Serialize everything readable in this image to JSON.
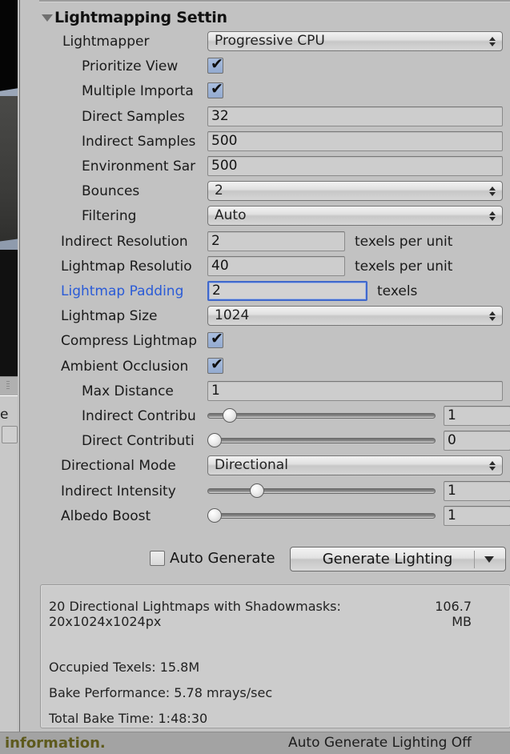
{
  "panel": {
    "foldout_title": "Lightmapping Settin",
    "foldout_arrow_icon": "triangle-down-icon"
  },
  "rows": [
    {
      "name": "lightmapper",
      "label": "Lightmapper",
      "type": "popup",
      "value": "Progressive CPU"
    },
    {
      "name": "prioritize-view",
      "label": "Prioritize View",
      "type": "checkbox",
      "value": "✔"
    },
    {
      "name": "multiple-importance",
      "label": "Multiple Importa",
      "type": "checkbox",
      "value": "✔"
    },
    {
      "name": "direct-samples",
      "label": "Direct Samples",
      "type": "field",
      "value": "32"
    },
    {
      "name": "indirect-samples",
      "label": "Indirect Samples",
      "type": "field",
      "value": "500"
    },
    {
      "name": "environment-samples",
      "label": "Environment Sar",
      "type": "field",
      "value": "500"
    },
    {
      "name": "bounces",
      "label": "Bounces",
      "type": "popup",
      "value": "2"
    },
    {
      "name": "filtering",
      "label": "Filtering",
      "type": "popup",
      "value": "Auto"
    },
    {
      "name": "indirect-resolution",
      "label": "Indirect Resolution",
      "type": "field",
      "value": "2",
      "unit": "texels per unit"
    },
    {
      "name": "lightmap-resolution",
      "label": "Lightmap Resolutio",
      "type": "field",
      "value": "40",
      "unit": "texels per unit"
    },
    {
      "name": "lightmap-padding",
      "label": "Lightmap Padding",
      "type": "field",
      "value": "2",
      "unit": "texels",
      "focused": true
    },
    {
      "name": "lightmap-size",
      "label": "Lightmap Size",
      "type": "popup",
      "value": "1024"
    },
    {
      "name": "compress-lightmaps",
      "label": "Compress Lightmap",
      "type": "checkbox",
      "value": "✔"
    },
    {
      "name": "ambient-occlusion",
      "label": "Ambient Occlusion",
      "type": "checkbox",
      "value": "✔"
    },
    {
      "name": "max-distance",
      "label": "Max Distance",
      "type": "field",
      "value": "1"
    },
    {
      "name": "indirect-contribution",
      "label": "Indirect Contribu",
      "type": "slider",
      "value": "1",
      "fill": 0.07
    },
    {
      "name": "direct-contribution",
      "label": "Direct Contributi",
      "type": "slider",
      "value": "0",
      "fill": 0.0
    },
    {
      "name": "directional-mode",
      "label": "Directional Mode",
      "type": "popup",
      "value": "Directional"
    },
    {
      "name": "indirect-intensity",
      "label": "Indirect Intensity",
      "type": "slider",
      "value": "1",
      "fill": 0.2
    },
    {
      "name": "albedo-boost",
      "label": "Albedo Boost",
      "type": "slider",
      "value": "1",
      "fill": 0.0
    }
  ],
  "scrollbar": {
    "down_arrow_icon": "triangle-down-icon"
  },
  "bake_bar": {
    "auto_generate_label": "Auto Generate",
    "auto_generate_checked": false,
    "generate_button_label": "Generate Lighting",
    "generate_dropdown_icon": "caret-down-icon"
  },
  "stats": {
    "lightmaps_title": "20 Directional Lightmaps with Shadowmasks:",
    "lightmaps_dims": "20x1024x1024px",
    "lightmaps_size_value": "106.7",
    "lightmaps_size_unit": "MB",
    "occupied_texels": "Occupied Texels: 15.8M",
    "bake_performance": "Bake Performance: 5.78 mrays/sec",
    "total_bake_time": "Total Bake Time: 1:48:30"
  },
  "statusbar": {
    "left_text": "information.",
    "right_text": "Auto Generate Lighting Off",
    "left_color": "#5e5a1d"
  },
  "sliver": {
    "clipped_letter": "e"
  }
}
